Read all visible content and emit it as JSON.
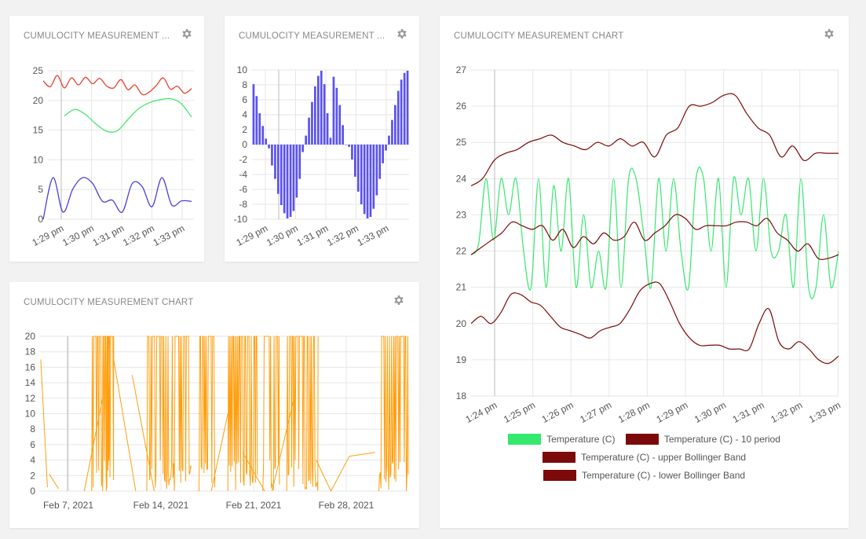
{
  "cards": [
    {
      "title": "CUMULOCITY MEASUREMENT ...",
      "chart_data": {
        "type": "line",
        "yticks": [
          "25",
          "20",
          "15",
          "10",
          "5",
          "0"
        ],
        "ylim": [
          0,
          25
        ],
        "xticks": [
          "1:29 pm",
          "1:30 pm",
          "1:31 pm",
          "1:32 pm",
          "1:33 pm"
        ],
        "series": [
          {
            "color": "#e8412c",
            "values": [
              23.3,
              22.3,
              24.2,
              22.1,
              23.8,
              22.6,
              23.9,
              22.8,
              23.7,
              22.4,
              22.1,
              23.5,
              21.8,
              22.6,
              21.0,
              21.4,
              22.5,
              23.8,
              21.9,
              22.4,
              21.2,
              22.0
            ]
          },
          {
            "color": "#44e86a",
            "values": [
              null,
              null,
              17.4,
              18.5,
              17.6,
              16.0,
              14.8,
              14.9,
              16.8,
              18.6,
              19.6,
              20.1,
              20.3,
              19.5,
              17.2
            ]
          },
          {
            "color": "#4b3fdc",
            "values": [
              0.0,
              7.0,
              1.2,
              5.1,
              7.0,
              6.0,
              3.0,
              3.2,
              1.2,
              6.0,
              5.5,
              2.1,
              7.0,
              2.4,
              3.1,
              3.0
            ]
          }
        ]
      }
    },
    {
      "title": "CUMULOCITY MEASUREMENT ...",
      "chart_data": {
        "type": "bar",
        "color": "#5a52f0",
        "yticks": [
          "10",
          "8",
          "6",
          "4",
          "2",
          "0",
          "-2",
          "-4",
          "-6",
          "-8",
          "-10"
        ],
        "ylim": [
          -10,
          10
        ],
        "xticks": [
          "1:29 pm",
          "1:30 pm",
          "1:31 pm",
          "1:32 pm",
          "1:33 pm"
        ],
        "values": [
          8.1,
          6.5,
          4.2,
          2.5,
          0.8,
          -0.5,
          -2.8,
          -4.6,
          -6.6,
          -8.1,
          -9.2,
          -9.9,
          -9.7,
          -8.9,
          -7.1,
          -4.6,
          -1.0,
          1.2,
          3.6,
          5.7,
          7.8,
          9.2,
          9.9,
          8.1,
          4.2,
          0.9,
          9.1,
          7.6,
          5.3,
          2.6,
          0.0,
          -0.3,
          -2.0,
          -4.3,
          -6.3,
          -8.0,
          -9.3,
          -9.9,
          -9.7,
          -8.6,
          -6.8,
          -4.6,
          -2.5,
          -0.8,
          1.2,
          3.3,
          5.3,
          7.2,
          8.7,
          9.6,
          9.9
        ]
      }
    },
    {
      "title": "CUMULOCITY MEASUREMENT CHART",
      "chart_data": {
        "type": "line",
        "yticks": [
          "27",
          "26",
          "25",
          "24",
          "23",
          "22",
          "21",
          "20",
          "19",
          "18"
        ],
        "ylim": [
          18,
          27
        ],
        "xticks": [
          "1:24 pm",
          "1:25 pm",
          "1:26 pm",
          "1:27 pm",
          "1:28 pm",
          "1:29 pm",
          "1:30 pm",
          "1:31 pm",
          "1:32 pm",
          "1:33 pm"
        ],
        "legend": [
          {
            "label": "Temperature (C)",
            "color": "#35e86e"
          },
          {
            "label": "Temperature (C) - 10 period",
            "color": "#7d0a0a"
          },
          {
            "label": "Temperature (C) - upper Bollinger Band",
            "color": "#7d0a0a"
          },
          {
            "label": "Temperature (C) - lower Bollinger Band",
            "color": "#7d0a0a"
          }
        ],
        "series": [
          {
            "name": "Temperature (C)",
            "color": "#35e86e",
            "width": 1.2,
            "values": [
              21.9,
              22.2,
              24.0,
              22.3,
              24.0,
              23.0,
              24.0,
              22.0,
              21.0,
              24.0,
              21.0,
              23.8,
              22.0,
              24.0,
              21.0,
              23.0,
              21.0,
              22.0,
              21.0,
              24.0,
              21.0,
              24.0,
              24.0,
              22.5,
              21.0,
              24.0,
              22.0,
              24.0,
              22.0,
              21.0,
              24.0,
              24.0,
              22.0,
              24.0,
              21.0,
              24.0,
              23.0,
              24.0,
              22.0,
              24.0,
              22.0,
              22.0,
              23.0,
              21.0,
              24.0,
              21.0,
              21.0,
              23.0,
              21.0,
              22.0
            ]
          },
          {
            "name": "Temperature (C) - 10 period",
            "color": "#7d0a0a",
            "width": 1.2,
            "values": [
              21.9,
              22.1,
              22.3,
              22.5,
              22.8,
              22.7,
              22.6,
              22.7,
              22.3,
              22.6,
              22.1,
              22.4,
              22.2,
              22.5,
              22.3,
              22.4,
              22.8,
              22.3,
              22.5,
              22.7,
              23.0,
              22.9,
              22.6,
              22.7,
              22.7,
              22.7,
              22.8,
              22.8,
              22.7,
              22.9,
              22.5,
              22.3,
              22.0,
              22.2,
              21.8,
              21.8,
              21.9
            ]
          },
          {
            "name": "Temperature (C) - upper Bollinger Band",
            "color": "#7d0a0a",
            "width": 1.2,
            "values": [
              23.8,
              24.0,
              24.5,
              24.7,
              24.8,
              25.0,
              25.1,
              25.2,
              25.0,
              24.9,
              24.8,
              25.0,
              24.9,
              25.1,
              24.9,
              25.0,
              24.6,
              25.2,
              25.4,
              26.0,
              26.0,
              26.1,
              26.3,
              26.3,
              25.8,
              25.4,
              25.2,
              24.6,
              24.9,
              24.5,
              24.7,
              24.7,
              24.7
            ]
          },
          {
            "name": "Temperature (C) - lower Bollinger Band",
            "color": "#7d0a0a",
            "width": 1.2,
            "values": [
              20.0,
              20.2,
              20.0,
              20.3,
              20.8,
              20.8,
              20.6,
              20.5,
              20.2,
              19.9,
              19.8,
              19.7,
              19.6,
              19.8,
              19.9,
              20.0,
              20.4,
              20.9,
              21.1,
              21.1,
              20.6,
              20.0,
              19.6,
              19.4,
              19.4,
              19.4,
              19.3,
              19.3,
              19.3,
              20.0,
              20.4,
              19.5,
              19.3,
              19.5,
              19.3,
              19.0,
              18.9,
              19.1
            ]
          }
        ]
      }
    },
    {
      "title": "CUMULOCITY MEASUREMENT CHART",
      "chart_data": {
        "type": "line",
        "color": "#ff9f0f",
        "yticks": [
          "20",
          "18",
          "16",
          "14",
          "12",
          "10",
          "8",
          "6",
          "4",
          "2",
          "0"
        ],
        "ylim": [
          0,
          20
        ],
        "xticks": [
          "Feb 7, 2021",
          "Feb 14, 2021",
          "Feb 21, 2021",
          "Feb 28, 2021"
        ],
        "bursts": [
          [
            14.0,
            20.0
          ],
          [
            17.0,
            19.0
          ],
          [
            18.0,
            18.5
          ],
          [
            29.0,
            41.0
          ],
          [
            43.0,
            47.5
          ],
          [
            51.0,
            59.0
          ],
          [
            60.5,
            65.0
          ],
          [
            67.0,
            75.5
          ],
          [
            92.0,
            100.0
          ]
        ],
        "links": [
          [
            0.2,
            17.0,
            2.0,
            0.5
          ],
          [
            2.5,
            2.2,
            5.0,
            0.3
          ],
          [
            12.0,
            0.0,
            17.0,
            12.0
          ],
          [
            20.0,
            17.0,
            26.0,
            0.0
          ],
          [
            25.0,
            15.0,
            31.0,
            0.0
          ],
          [
            46.5,
            0.0,
            51.0,
            10.0
          ],
          [
            55.0,
            5.0,
            61.0,
            0.0
          ],
          [
            63.0,
            0.0,
            69.0,
            12.0
          ],
          [
            75.0,
            4.0,
            79.0,
            0.0
          ],
          [
            79.0,
            0.0,
            84.0,
            4.5
          ],
          [
            84.0,
            4.5,
            91.0,
            5.0
          ]
        ]
      }
    }
  ]
}
